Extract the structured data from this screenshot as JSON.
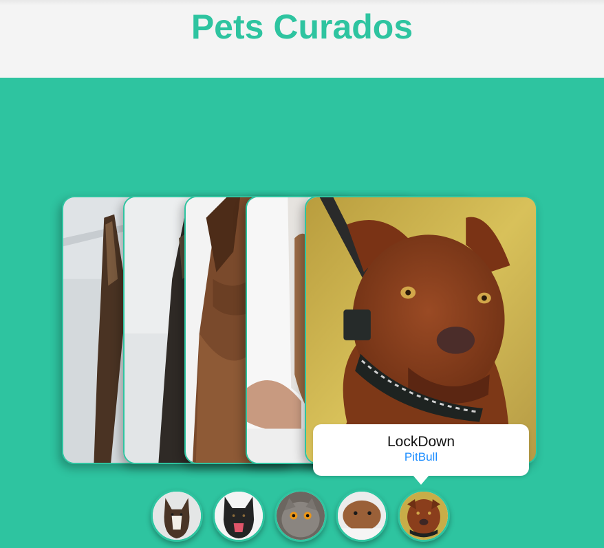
{
  "header": {
    "title": "Pets Curados"
  },
  "selected": {
    "name": "LockDown",
    "breed": "PitBull"
  },
  "colors": {
    "accent": "#2ec4a0",
    "breed_text": "#1a8cff",
    "header_bg": "#f4f4f4"
  },
  "cards": [
    {
      "image": "dog-in-snow-photo"
    },
    {
      "image": "dark-dog-in-snow-photo"
    },
    {
      "image": "brown-dog-ear-photo"
    },
    {
      "image": "guinea-pig-on-towel-photo"
    },
    {
      "image": "brown-pitbull-photo"
    }
  ],
  "thumbnails": [
    {
      "image": "brindle-dog-thumb"
    },
    {
      "image": "black-dog-thumb"
    },
    {
      "image": "gray-cat-thumb"
    },
    {
      "image": "guinea-pig-thumb"
    },
    {
      "image": "pitbull-thumb"
    }
  ]
}
